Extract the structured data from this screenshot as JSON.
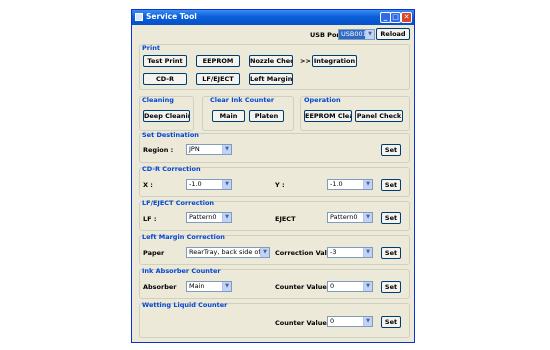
{
  "window": {
    "title": "Service Tool",
    "min": "_",
    "max": "□",
    "close": "✕"
  },
  "usb": {
    "label": "USB Port",
    "value": "USB001",
    "reload": "Reload"
  },
  "print": {
    "title": "Print",
    "test_print": "Test Print",
    "eeprom": "EEPROM",
    "nozzle_check": "Nozzle Check",
    "arrow": ">>",
    "integration": "Integration",
    "cdr": "CD-R",
    "lf_eject": "LF/EJECT",
    "left_margin": "Left Margin"
  },
  "cleaning": {
    "title": "Cleaning",
    "deep": "Deep Cleaning"
  },
  "clear_ink": {
    "title": "Clear Ink Counter",
    "main": "Main",
    "platen": "Platen"
  },
  "operation": {
    "title": "Operation",
    "eeprom_clear": "EEPROM Clear",
    "panel_check": "Panel Check"
  },
  "set_destination": {
    "title": "Set Destination",
    "region_label": "Region :",
    "region_value": "JPN",
    "set": "Set"
  },
  "cdr_correction": {
    "title": "CD-R Correction",
    "x_label": "X :",
    "x_value": "-1.0",
    "y_label": "Y :",
    "y_value": "-1.0",
    "set": "Set"
  },
  "lf_correction": {
    "title": "LF/EJECT Correction",
    "lf_label": "LF :",
    "lf_value": "Pattern0",
    "eject_label": "EJECT",
    "eject_value": "Pattern0",
    "set": "Set"
  },
  "lm_correction": {
    "title": "Left Margin Correction",
    "paper_label": "Paper",
    "paper_value": "RearTray, back side of p",
    "cv_label": "Correction Value",
    "cv_value": "-3",
    "set": "Set"
  },
  "ink_absorber": {
    "title": "Ink Absorber Counter",
    "absorber_label": "Absorber",
    "absorber_value": "Main",
    "cv_label": "Counter Value(%)",
    "cv_value": "0",
    "set": "Set"
  },
  "wetting": {
    "title": "Wetting Liquid Counter",
    "cv_label": "Counter Value(%)",
    "cv_value": "0",
    "set": "Set"
  }
}
